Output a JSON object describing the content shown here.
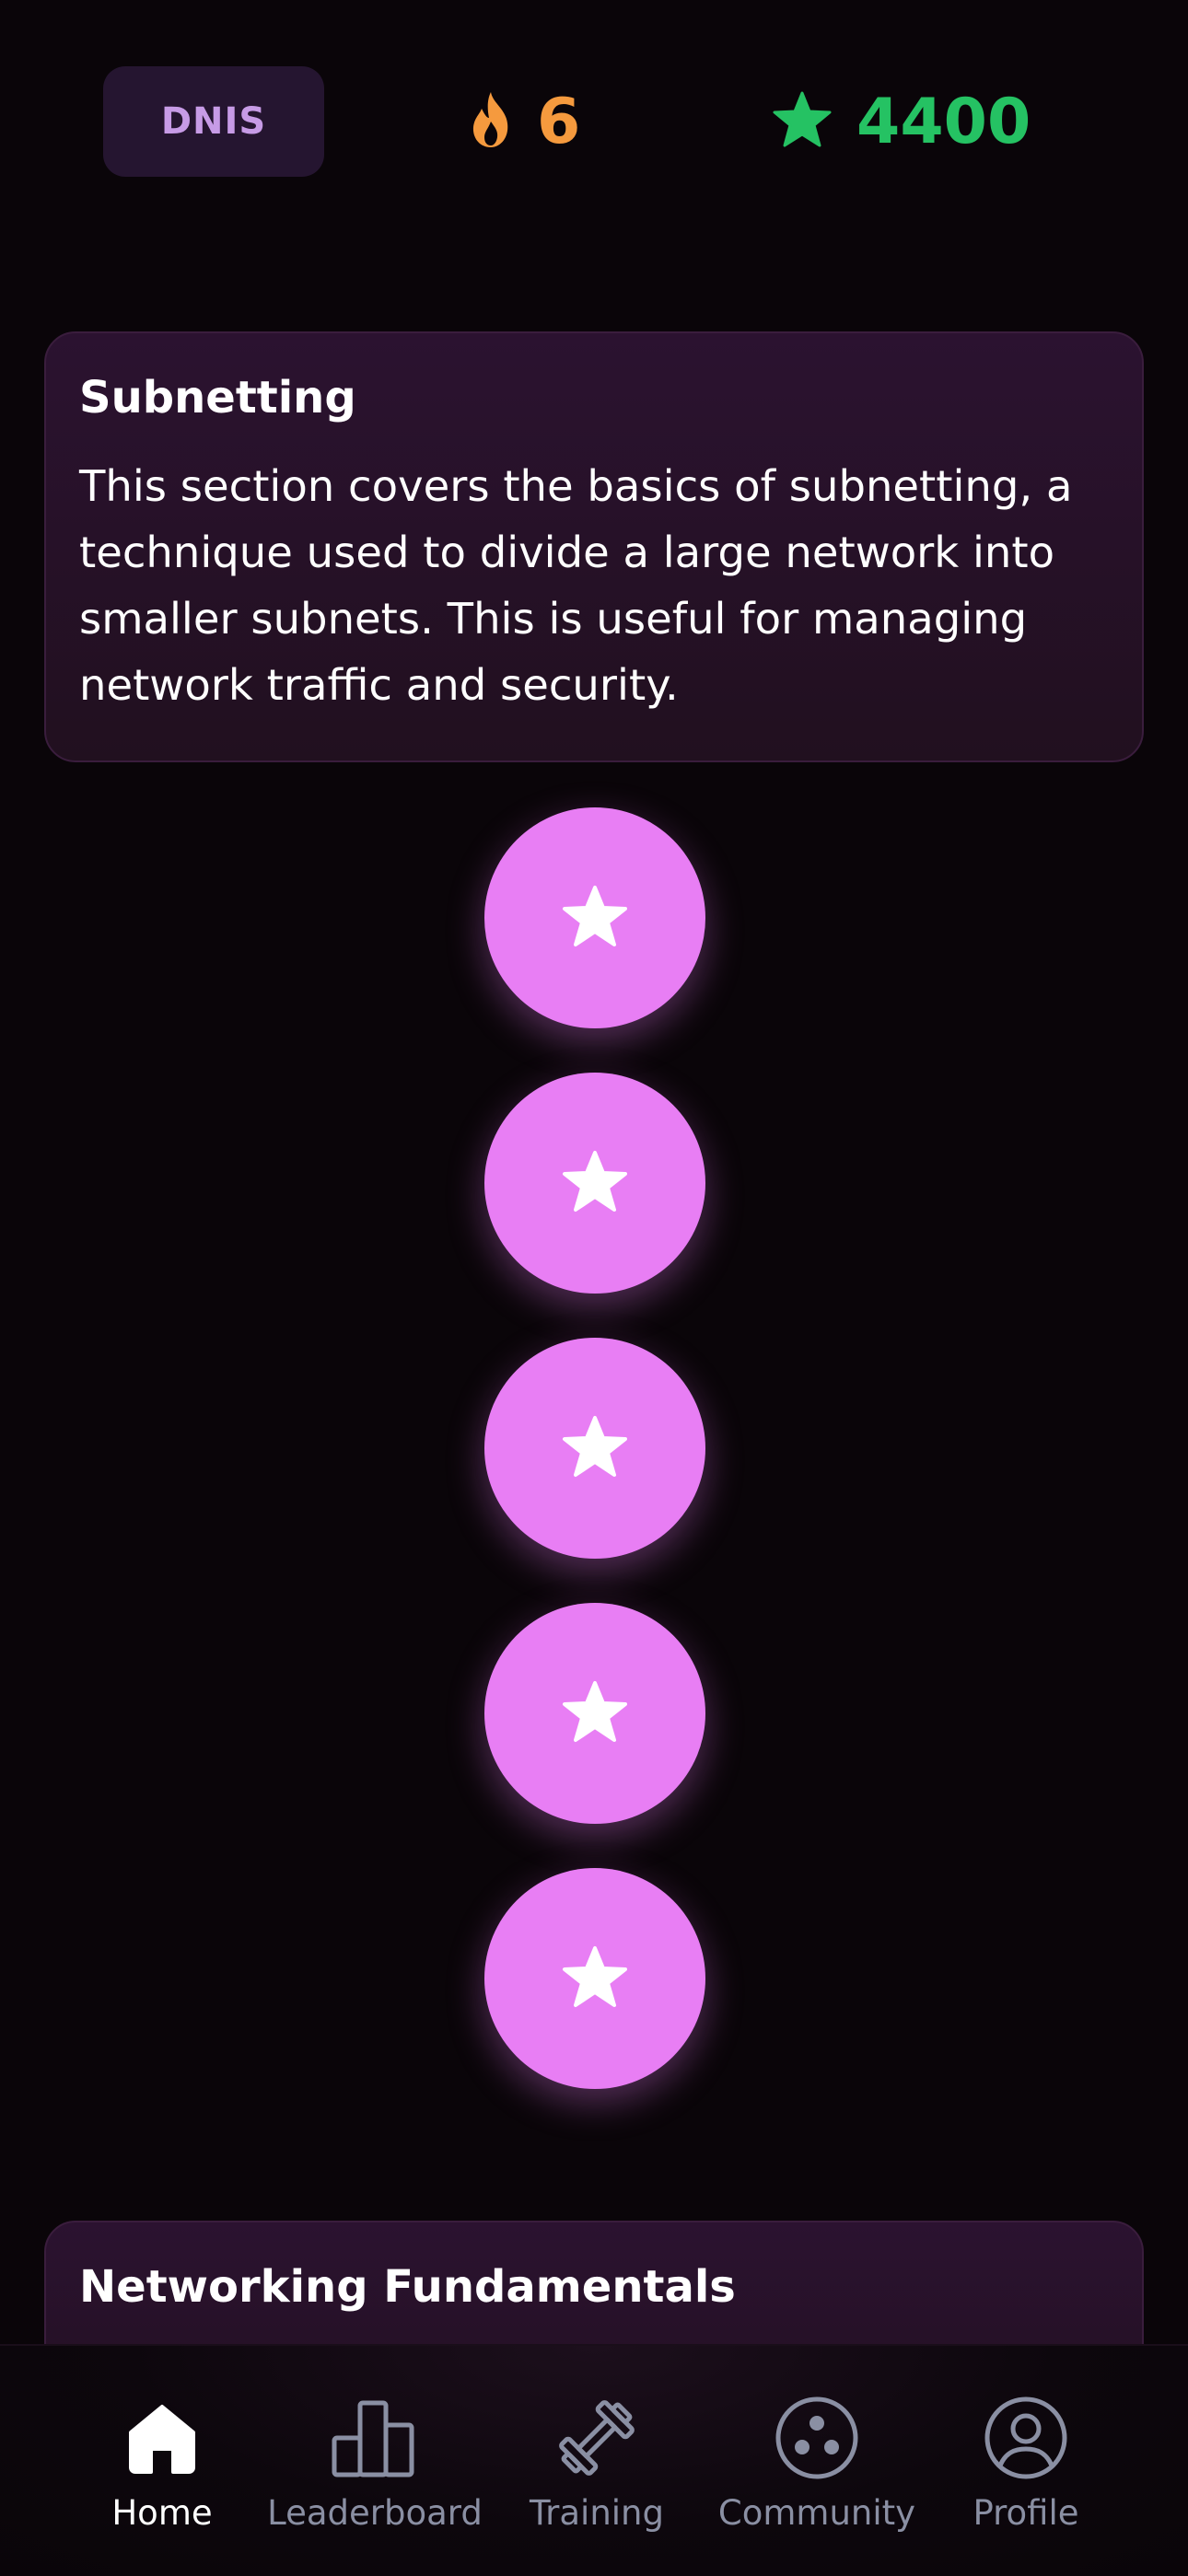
{
  "header": {
    "course_code": "DNIS",
    "streak_count": "6",
    "xp_total": "4400",
    "streak_icon": "flame-icon",
    "xp_icon": "star-icon",
    "streak_color": "#f59a3e",
    "xp_color": "#25c263"
  },
  "sections": [
    {
      "title": "Subnetting",
      "description": "This section covers the basics of subnetting, a technique used to divide a large network into smaller subnets. This is useful for managing network traffic and security."
    },
    {
      "title": "Networking Fundamentals"
    }
  ],
  "lessons": [
    {
      "icon": "star-icon",
      "color": "#e87ef4"
    },
    {
      "icon": "star-icon",
      "color": "#e87ef4"
    },
    {
      "icon": "star-icon",
      "color": "#e87ef4"
    },
    {
      "icon": "star-icon",
      "color": "#e87ef4"
    },
    {
      "icon": "star-icon",
      "color": "#e87ef4"
    }
  ],
  "nav": {
    "items": [
      {
        "label": "Home",
        "icon": "home-icon",
        "active": true
      },
      {
        "label": "Leaderboard",
        "icon": "bar-chart-icon",
        "active": false
      },
      {
        "label": "Training",
        "icon": "dumbbell-icon",
        "active": false
      },
      {
        "label": "Community",
        "icon": "community-icon",
        "active": false
      },
      {
        "label": "Profile",
        "icon": "user-circle-icon",
        "active": false
      }
    ]
  }
}
